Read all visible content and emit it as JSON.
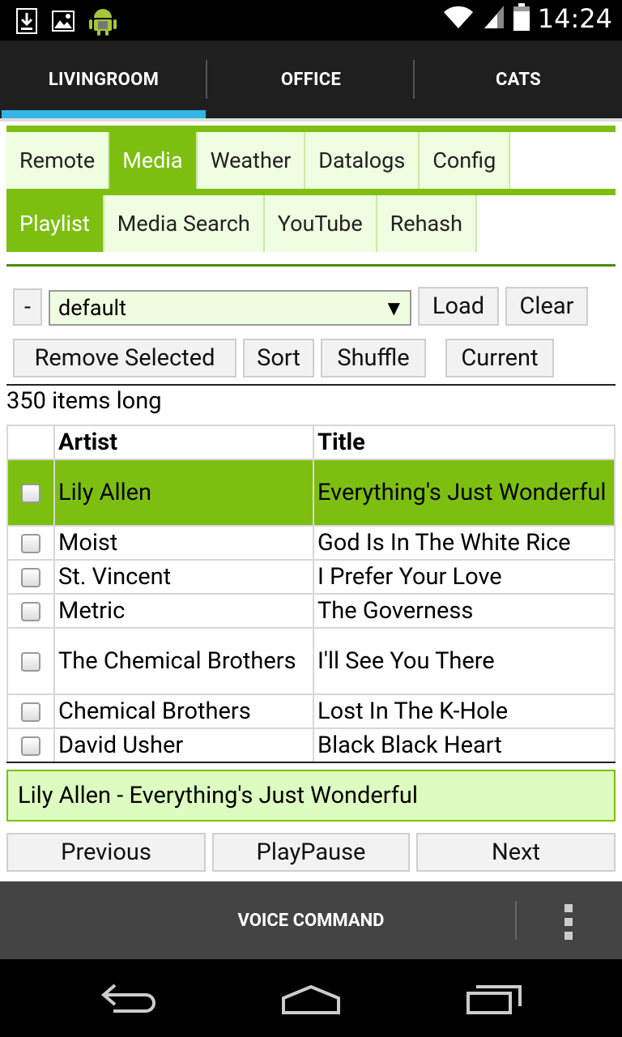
{
  "status_bar": {
    "time": "14:24",
    "left_icons": [
      "download-icon",
      "image-icon",
      "android-icon"
    ],
    "right_icons": [
      "wifi-icon",
      "signal-icon",
      "battery-icon"
    ]
  },
  "top_tabs": [
    {
      "label": "LIVINGROOM",
      "active": true
    },
    {
      "label": "OFFICE",
      "active": false
    },
    {
      "label": "CATS",
      "active": false
    }
  ],
  "main_nav": [
    "Remote",
    "Media",
    "Weather",
    "Datalogs",
    "Config"
  ],
  "main_nav_active": "Media",
  "sub_nav": [
    "Playlist",
    "Media Search",
    "YouTube",
    "Rehash"
  ],
  "sub_nav_active": "Playlist",
  "controls": {
    "minus_label": "-",
    "playlist_select": "default",
    "load_label": "Load",
    "clear_label": "Clear",
    "remove_selected_label": "Remove Selected",
    "sort_label": "Sort",
    "shuffle_label": "Shuffle",
    "current_label": "Current"
  },
  "count_text": "350 items long",
  "table": {
    "headers": [
      "Artist",
      "Title"
    ],
    "rows": [
      {
        "artist": "Lily Allen",
        "title": "Everything's Just Wonderful",
        "selected": true
      },
      {
        "artist": "Moist",
        "title": "God Is In The White Rice",
        "selected": false
      },
      {
        "artist": "St. Vincent",
        "title": "I Prefer Your Love",
        "selected": false
      },
      {
        "artist": "Metric",
        "title": "The Governess",
        "selected": false
      },
      {
        "artist": "The Chemical Brothers",
        "title": "I'll See You There",
        "selected": false
      },
      {
        "artist": "Chemical Brothers",
        "title": "Lost In The K-Hole",
        "selected": false
      },
      {
        "artist": "David Usher",
        "title": "Black Black Heart",
        "selected": false
      }
    ]
  },
  "now_playing": "Lily Allen - Everything's Just Wonderful",
  "transport": {
    "previous_label": "Previous",
    "playpause_label": "PlayPause",
    "next_label": "Next"
  },
  "action_bar": {
    "voice_label": "VOICE COMMAND"
  },
  "colors": {
    "accent_green": "#7dbf11",
    "tab_indicator": "#33b5e5"
  }
}
